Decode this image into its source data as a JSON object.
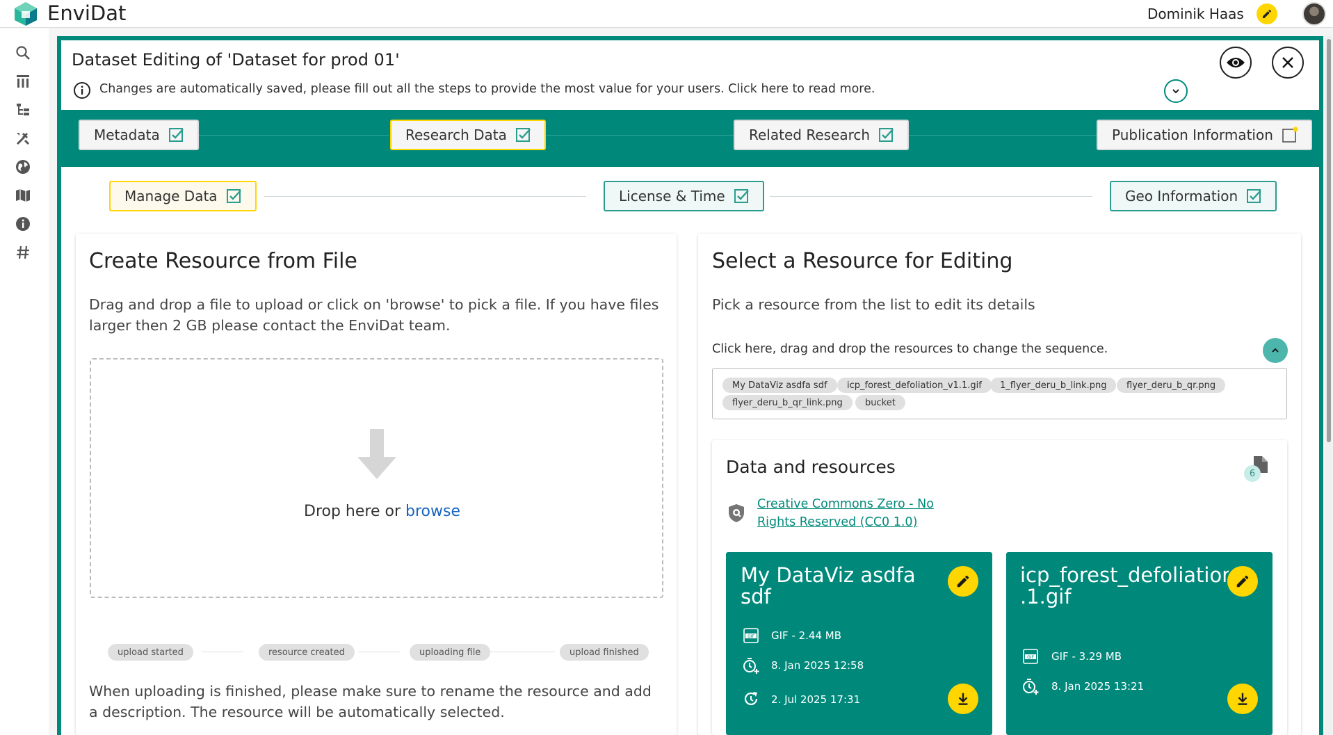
{
  "app": {
    "title": "EnviDat"
  },
  "user": {
    "name": "Dominik Haas"
  },
  "colors": {
    "primary": "#00897b",
    "accent": "#ffd600"
  },
  "sidebar": {
    "items": [
      {
        "icon": "search-icon"
      },
      {
        "icon": "dataset-list-icon"
      },
      {
        "icon": "organization-tree-icon"
      },
      {
        "icon": "tools-icon"
      },
      {
        "icon": "globe-icon"
      },
      {
        "icon": "map-book-icon"
      },
      {
        "icon": "info-icon"
      },
      {
        "icon": "hashtag-icon"
      }
    ]
  },
  "header": {
    "title": "Dataset Editing of 'Dataset for prod 01'",
    "info": "Changes are automatically saved, please fill out all the steps to provide the most value for your users. Click here to read more."
  },
  "steps": [
    {
      "label": "Metadata",
      "complete": true
    },
    {
      "label": "Research Data",
      "complete": true,
      "active": true
    },
    {
      "label": "Related Research",
      "complete": true
    },
    {
      "label": "Publication Information",
      "complete": false,
      "warning": true
    }
  ],
  "substeps": [
    {
      "label": "Manage Data",
      "complete": true,
      "active": true
    },
    {
      "label": "License & Time",
      "complete": true
    },
    {
      "label": "Geo Information",
      "complete": true
    }
  ],
  "create": {
    "title": "Create Resource from File",
    "description": "Drag and drop a file to upload or click on 'browse' to pick a file. If you have files larger then 2 GB please contact the EnviDat team.",
    "drop_text": "Drop here or",
    "browse_label": "browse",
    "status": [
      "upload started",
      "resource created",
      "uploading file",
      "upload finished"
    ],
    "footer": "When uploading is finished, please make sure to rename the resource and add a description. The resource will be automatically selected."
  },
  "select": {
    "title": "Select a Resource for Editing",
    "description": "Pick a resource from the list to edit its details",
    "sequence_hint": "Click here, drag and drop the resources to change the sequence.",
    "resources": [
      "My DataViz asdfa sdf",
      "icp_forest_defoliation_v1.1.gif",
      "1_flyer_deru_b_link.png",
      "flyer_deru_b_qr.png",
      "flyer_deru_b_qr_link.png",
      "bucket"
    ]
  },
  "data_resources": {
    "title": "Data and resources",
    "count": "6",
    "license_line1": "Creative Commons Zero - No",
    "license_line2": "Rights Reserved (CC0 1.0)",
    "cards": [
      {
        "name": "My DataViz asdfa sdf",
        "format": "GIF - 2.44 MB",
        "created": "8. Jan 2025 12:58",
        "modified": "2. Jul 2025 17:31"
      },
      {
        "name_line1": "icp_forest_defoliation",
        "name_line2": ".1.gif",
        "format": "GIF - 3.29 MB",
        "created": "8. Jan 2025 13:21"
      }
    ]
  }
}
